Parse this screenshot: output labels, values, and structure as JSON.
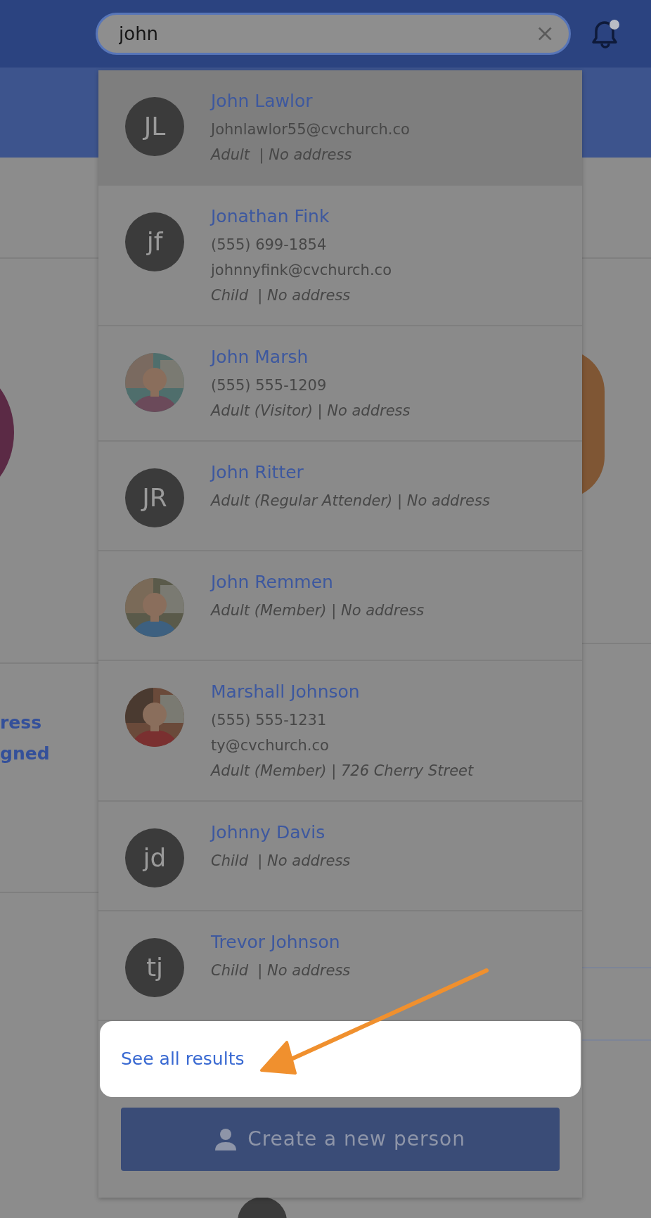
{
  "search": {
    "value": "john"
  },
  "notifications": {
    "unread": true
  },
  "background": {
    "texts": [
      "ress",
      "gned"
    ]
  },
  "results": [
    {
      "kind": "initials",
      "initials": "JL",
      "name": "John Lawlor",
      "lines": [
        "Johnlawlor55@cvchurch.co"
      ],
      "meta": "Adult  | No address",
      "selected": true
    },
    {
      "kind": "initials",
      "initials": "jf",
      "name": "Jonathan Fink",
      "lines": [
        "(555) 699-1854",
        "johnnyfink@cvchurch.co"
      ],
      "meta": "Child  | No address",
      "selected": false
    },
    {
      "name": "John Marsh",
      "lines": [
        "(555) 555-1209"
      ],
      "meta": "Adult (Visitor) | No address",
      "selected": false
    },
    {
      "kind": "initials",
      "initials": "JR",
      "name": "John Ritter",
      "meta": "Adult (Regular Attender) | No address",
      "selected": false
    },
    {
      "name": "John Remmen",
      "meta": "Adult (Member) | No address",
      "selected": false
    },
    {
      "name": "Marshall Johnson",
      "lines": [
        "(555) 555-1231",
        "ty@cvchurch.co"
      ],
      "meta": "Adult (Member) | 726 Cherry Street",
      "selected": false
    },
    {
      "kind": "initials",
      "initials": "jd",
      "name": "Johnny Davis",
      "meta": "Child  | No address",
      "selected": false
    },
    {
      "kind": "initials",
      "initials": "tj",
      "name": "Trevor Johnson",
      "meta": "Child  | No address",
      "selected": false
    }
  ],
  "see_all": {
    "label": "See all results",
    "highlighted": true
  },
  "create_button": {
    "label": "Create a new person"
  }
}
